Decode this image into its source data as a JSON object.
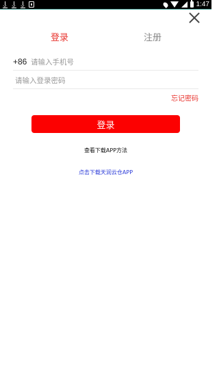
{
  "status_bar": {
    "time": "1:47",
    "left_icons": [
      "download-icon",
      "download-icon",
      "download-icon",
      "app-notification-icon"
    ],
    "right_icons": [
      "location-icon",
      "wifi-icon",
      "signal-icon",
      "battery-icon"
    ]
  },
  "tabs": {
    "login": "登录",
    "register": "注册",
    "active": "login"
  },
  "form": {
    "country_code": "+86",
    "phone_placeholder": "请输入手机号",
    "password_placeholder": "请输入登录密码",
    "forgot_password": "忘记密码",
    "login_button": "登录"
  },
  "links": {
    "howto": "查看下载APP方法",
    "download": "点击下载天润云仓APP"
  },
  "colors": {
    "accent": "#e8352f",
    "button": "#fc0101",
    "link": "#2a3ad8",
    "status_bar": "#000000",
    "status_accent_line": "#4aa59c"
  }
}
